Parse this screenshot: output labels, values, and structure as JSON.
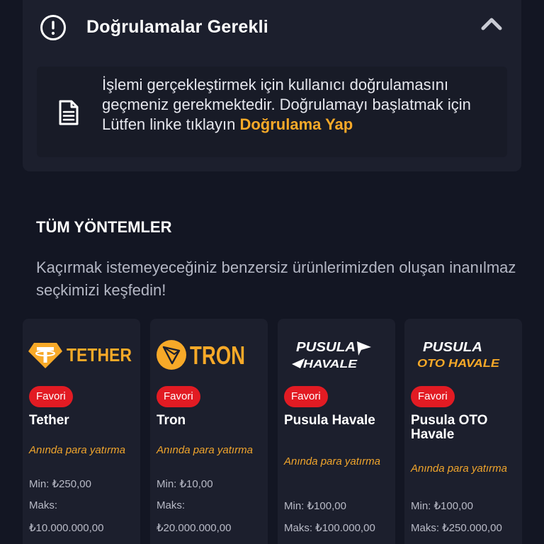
{
  "verification": {
    "title": "Doğrulamalar Gerekli",
    "message": "İşlemi gerçekleştirmek için kullanıcı doğrulamasını geçmeniz gerekmektedir. Doğrulamayı başlatmak için Lütfen linke tıklayın",
    "link_label": "Doğrulama Yap",
    "icons": [
      "alert-circle-icon",
      "chevron-up-icon",
      "document-icon"
    ]
  },
  "section": {
    "title": "TÜM YÖNTEMLER",
    "description": "Kaçırmak istemeyeceğiniz benzersiz ürünlerimizden oluşan inanılmaz seçkimizi keşfedin!"
  },
  "methods": [
    {
      "logo_text": "TETHER",
      "badge": "Favori",
      "name": "Tether",
      "tagline": "Anında para yatırma",
      "min": "Min: ₺250,00",
      "max_label": "Maks:",
      "max_value": "₺10.000.000,00"
    },
    {
      "logo_text": "TRON",
      "badge": "Favori",
      "name": "Tron",
      "tagline": "Anında para yatırma",
      "min": "Min: ₺10,00",
      "max_label": "Maks:",
      "max_value": "₺20.000.000,00"
    },
    {
      "logo_line1": "PUSULA",
      "logo_line2": "HAVALE",
      "badge": "Favori",
      "name": "Pusula Havale",
      "tagline": "Anında para yatırma",
      "min": "Min: ₺100,00",
      "max": "Maks: ₺100.000,00"
    },
    {
      "logo_line1": "PUSULA",
      "logo_line2": "OTO HAVALE",
      "badge": "Favori",
      "name": "Pusula OTO Havale",
      "tagline": "Anında para yatırma",
      "min": "Min: ₺100,00",
      "max": "Maks: ₺250.000,00"
    }
  ],
  "colors": {
    "background": "#131623",
    "card": "#1c1f2d",
    "accent": "#f7a928",
    "badge": "#e21b23"
  }
}
